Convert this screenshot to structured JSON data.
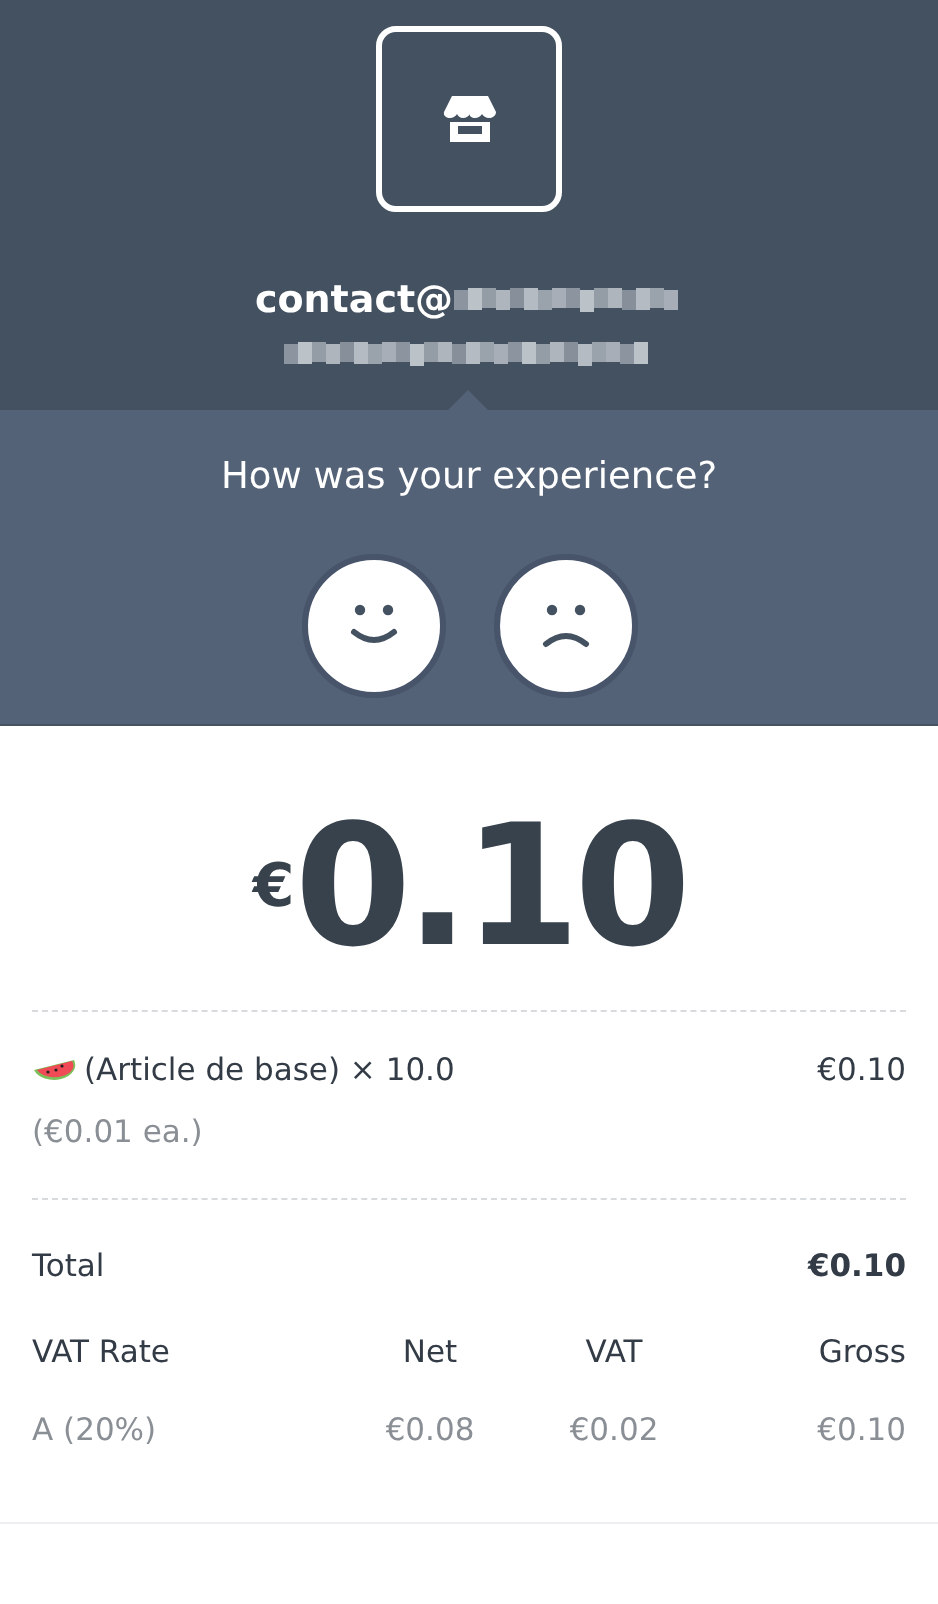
{
  "header": {
    "email": "contact@"
  },
  "feedback": {
    "question": "How was your experience?",
    "options": [
      {
        "kind": "happy"
      },
      {
        "kind": "sad"
      }
    ]
  },
  "amount": {
    "currency": "€",
    "value": "0.10"
  },
  "items": [
    {
      "name": "(Article de base) × 10.0",
      "price": "€0.10",
      "unit_price": "(€0.01 ea.)"
    }
  ],
  "total": {
    "label": "Total",
    "value": "€0.10"
  },
  "vat": {
    "columns": [
      "VAT Rate",
      "Net",
      "VAT",
      "Gross"
    ],
    "rows": [
      [
        "A (20%)",
        "€0.08",
        "€0.02",
        "€0.10"
      ]
    ]
  }
}
